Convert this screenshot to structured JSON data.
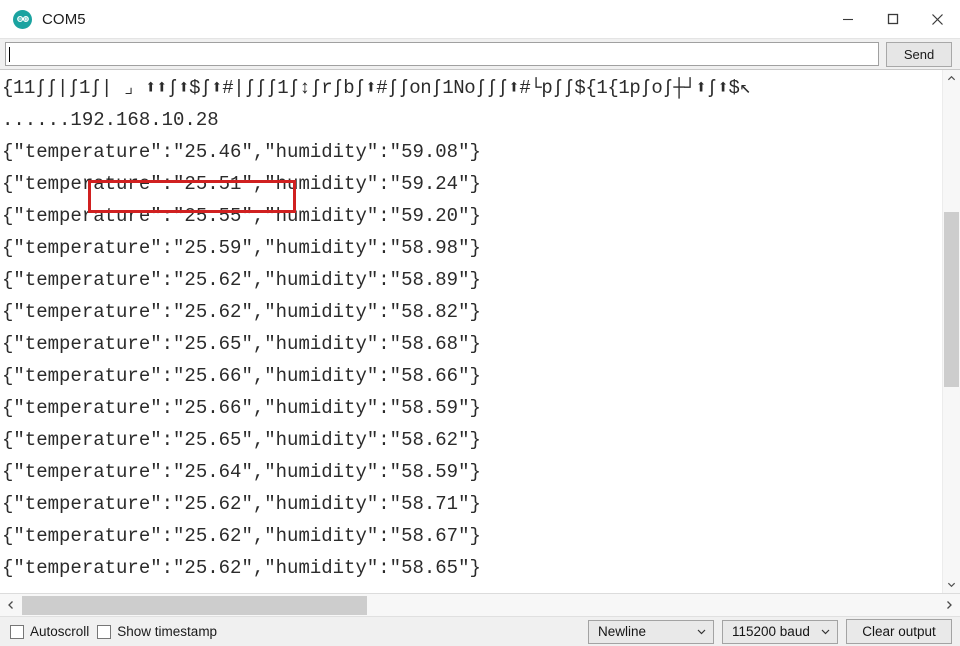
{
  "window": {
    "title": "COM5",
    "app_icon": "arduino-infinity-icon",
    "controls": {
      "minimize": "minimize-icon",
      "maximize": "maximize-icon",
      "close": "close-icon"
    }
  },
  "send_bar": {
    "input_value": "",
    "input_placeholder": "",
    "send_label": "Send"
  },
  "console": {
    "lines": [
      "{11ʃʃ|ʃ1ʃ| ⌟ ⬆⬆ʃ⬆$ʃ⬆#|ʃʃʃ1ʃ↕ʃrʃbʃ⬆#ʃʃonʃ1Noʃʃʃ⬆#└pʃʃ${1{1pʃoʃ┼┘⬆ʃ⬆$↖",
      "......192.168.10.28",
      "{\"temperature\":\"25.46\",\"humidity\":\"59.08\"}",
      "{\"temperature\":\"25.51\",\"humidity\":\"59.24\"}",
      "{\"temperature\":\"25.55\",\"humidity\":\"59.20\"}",
      "{\"temperature\":\"25.59\",\"humidity\":\"58.98\"}",
      "{\"temperature\":\"25.62\",\"humidity\":\"58.89\"}",
      "{\"temperature\":\"25.62\",\"humidity\":\"58.82\"}",
      "{\"temperature\":\"25.65\",\"humidity\":\"58.68\"}",
      "{\"temperature\":\"25.66\",\"humidity\":\"58.66\"}",
      "{\"temperature\":\"25.66\",\"humidity\":\"58.59\"}",
      "{\"temperature\":\"25.65\",\"humidity\":\"58.62\"}",
      "{\"temperature\":\"25.64\",\"humidity\":\"58.59\"}",
      "{\"temperature\":\"25.62\",\"humidity\":\"58.71\"}",
      "{\"temperature\":\"25.62\",\"humidity\":\"58.67\"}",
      "{\"temperature\":\"25.62\",\"humidity\":\"58.65\"}"
    ],
    "highlight": {
      "text": "192.168.10.28",
      "color": "#d02020"
    }
  },
  "scrollbars": {
    "vertical": {
      "up": "chevron-up-icon",
      "down": "chevron-down-icon"
    },
    "horizontal": {
      "left": "chevron-left-icon",
      "right": "chevron-right-icon"
    }
  },
  "status_bar": {
    "autoscroll_label": "Autoscroll",
    "autoscroll_checked": false,
    "timestamp_label": "Show timestamp",
    "timestamp_checked": false,
    "line_ending": "Newline",
    "baud_rate": "115200 baud",
    "clear_label": "Clear output"
  }
}
